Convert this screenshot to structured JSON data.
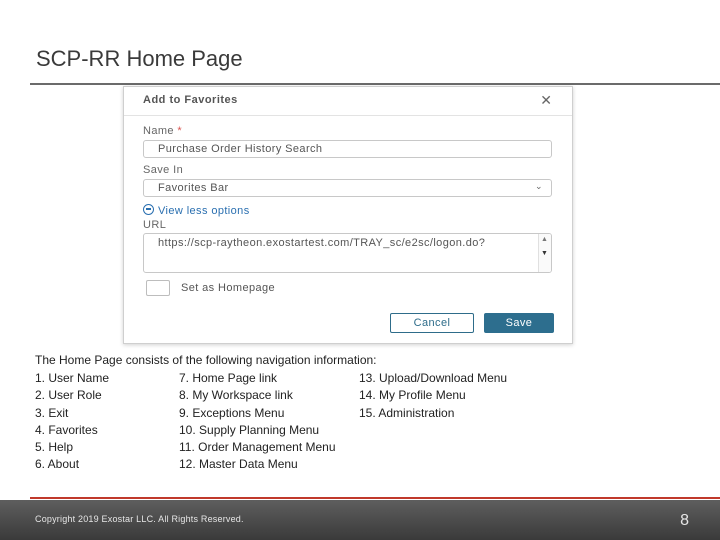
{
  "slide": {
    "title": "SCP-RR Home Page"
  },
  "dialog": {
    "title": "Add to Favorites",
    "name_label": "Name",
    "required_mark": "*",
    "name_value": "Purchase Order History Search",
    "save_in_label": "Save In",
    "save_in_value": "Favorites Bar",
    "toggle_label": "View less options",
    "url_label": "URL",
    "url_value": "https://scp-raytheon.exostartest.com/TRAY_sc/e2sc/logon.do?",
    "homepage_label": "Set as Homepage",
    "cancel_label": "Cancel",
    "save_label": "Save"
  },
  "nav": {
    "intro": "The Home Page consists of the following navigation information:",
    "rows": [
      [
        "1. User Name",
        "7. Home Page link",
        "13. Upload/Download Menu"
      ],
      [
        "2. User Role",
        "8. My Workspace link",
        "14. My Profile Menu"
      ],
      [
        "3. Exit",
        "9. Exceptions Menu",
        "15. Administration"
      ],
      [
        "4. Favorites",
        "10. Supply Planning Menu",
        ""
      ],
      [
        "5. Help",
        "11. Order Management Menu",
        ""
      ],
      [
        "6. About",
        "12. Master Data Menu",
        ""
      ]
    ]
  },
  "footer": {
    "copyright": "Copyright 2019 Exostar LLC. All Rights Reserved.",
    "page_number": "8"
  },
  "colors": {
    "accent_line": "#c0392b",
    "save_button": "#2d6e8e",
    "link": "#2a6fb0"
  },
  "icons": [
    "close-icon",
    "chevron-down-icon",
    "minus-circle-icon",
    "scroll-up-icon",
    "scroll-down-icon"
  ]
}
